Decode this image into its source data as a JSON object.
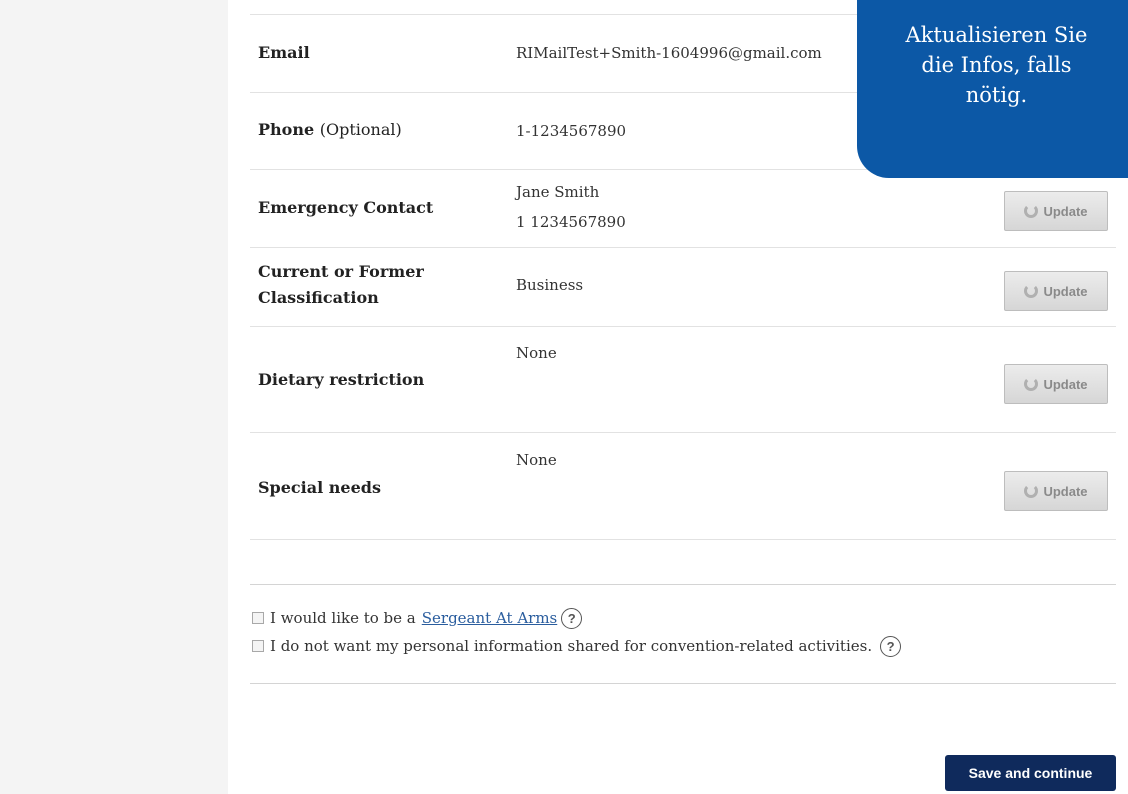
{
  "fields": [
    {
      "label": "Email",
      "value_lines": [
        "RIMailTest+Smith-1604996@gmail.com"
      ]
    },
    {
      "label": "Phone",
      "label_note": "(Optional)",
      "value_lines": [
        "1-1234567890"
      ]
    },
    {
      "label": "Emergency Contact",
      "value_lines": [
        "Jane Smith",
        "1 1234567890"
      ],
      "button": "Update"
    },
    {
      "label_lines": [
        "Current or Former",
        "Classification"
      ],
      "value_lines": [
        "Business"
      ],
      "button": "Update"
    },
    {
      "label": "Dietary restriction",
      "value_lines": [
        "None"
      ],
      "button": "Update"
    },
    {
      "label": "Special needs",
      "value_lines": [
        "None"
      ],
      "button": "Update"
    }
  ],
  "options": {
    "sergeant_prefix": "I would like to be a",
    "sergeant_link": "Sergeant At Arms",
    "privacy_text": "I do not want my personal information shared for convention-related activities.",
    "help_glyph": "?"
  },
  "actions": {
    "save_label": "Save and continue"
  },
  "callout": {
    "lines": [
      "Aktualisieren Sie",
      "die Infos, falls",
      "nötig."
    ]
  },
  "colors": {
    "callout_bg": "#0c58a6",
    "save_bg": "#0f2a5c",
    "link": "#2a5d9e"
  }
}
